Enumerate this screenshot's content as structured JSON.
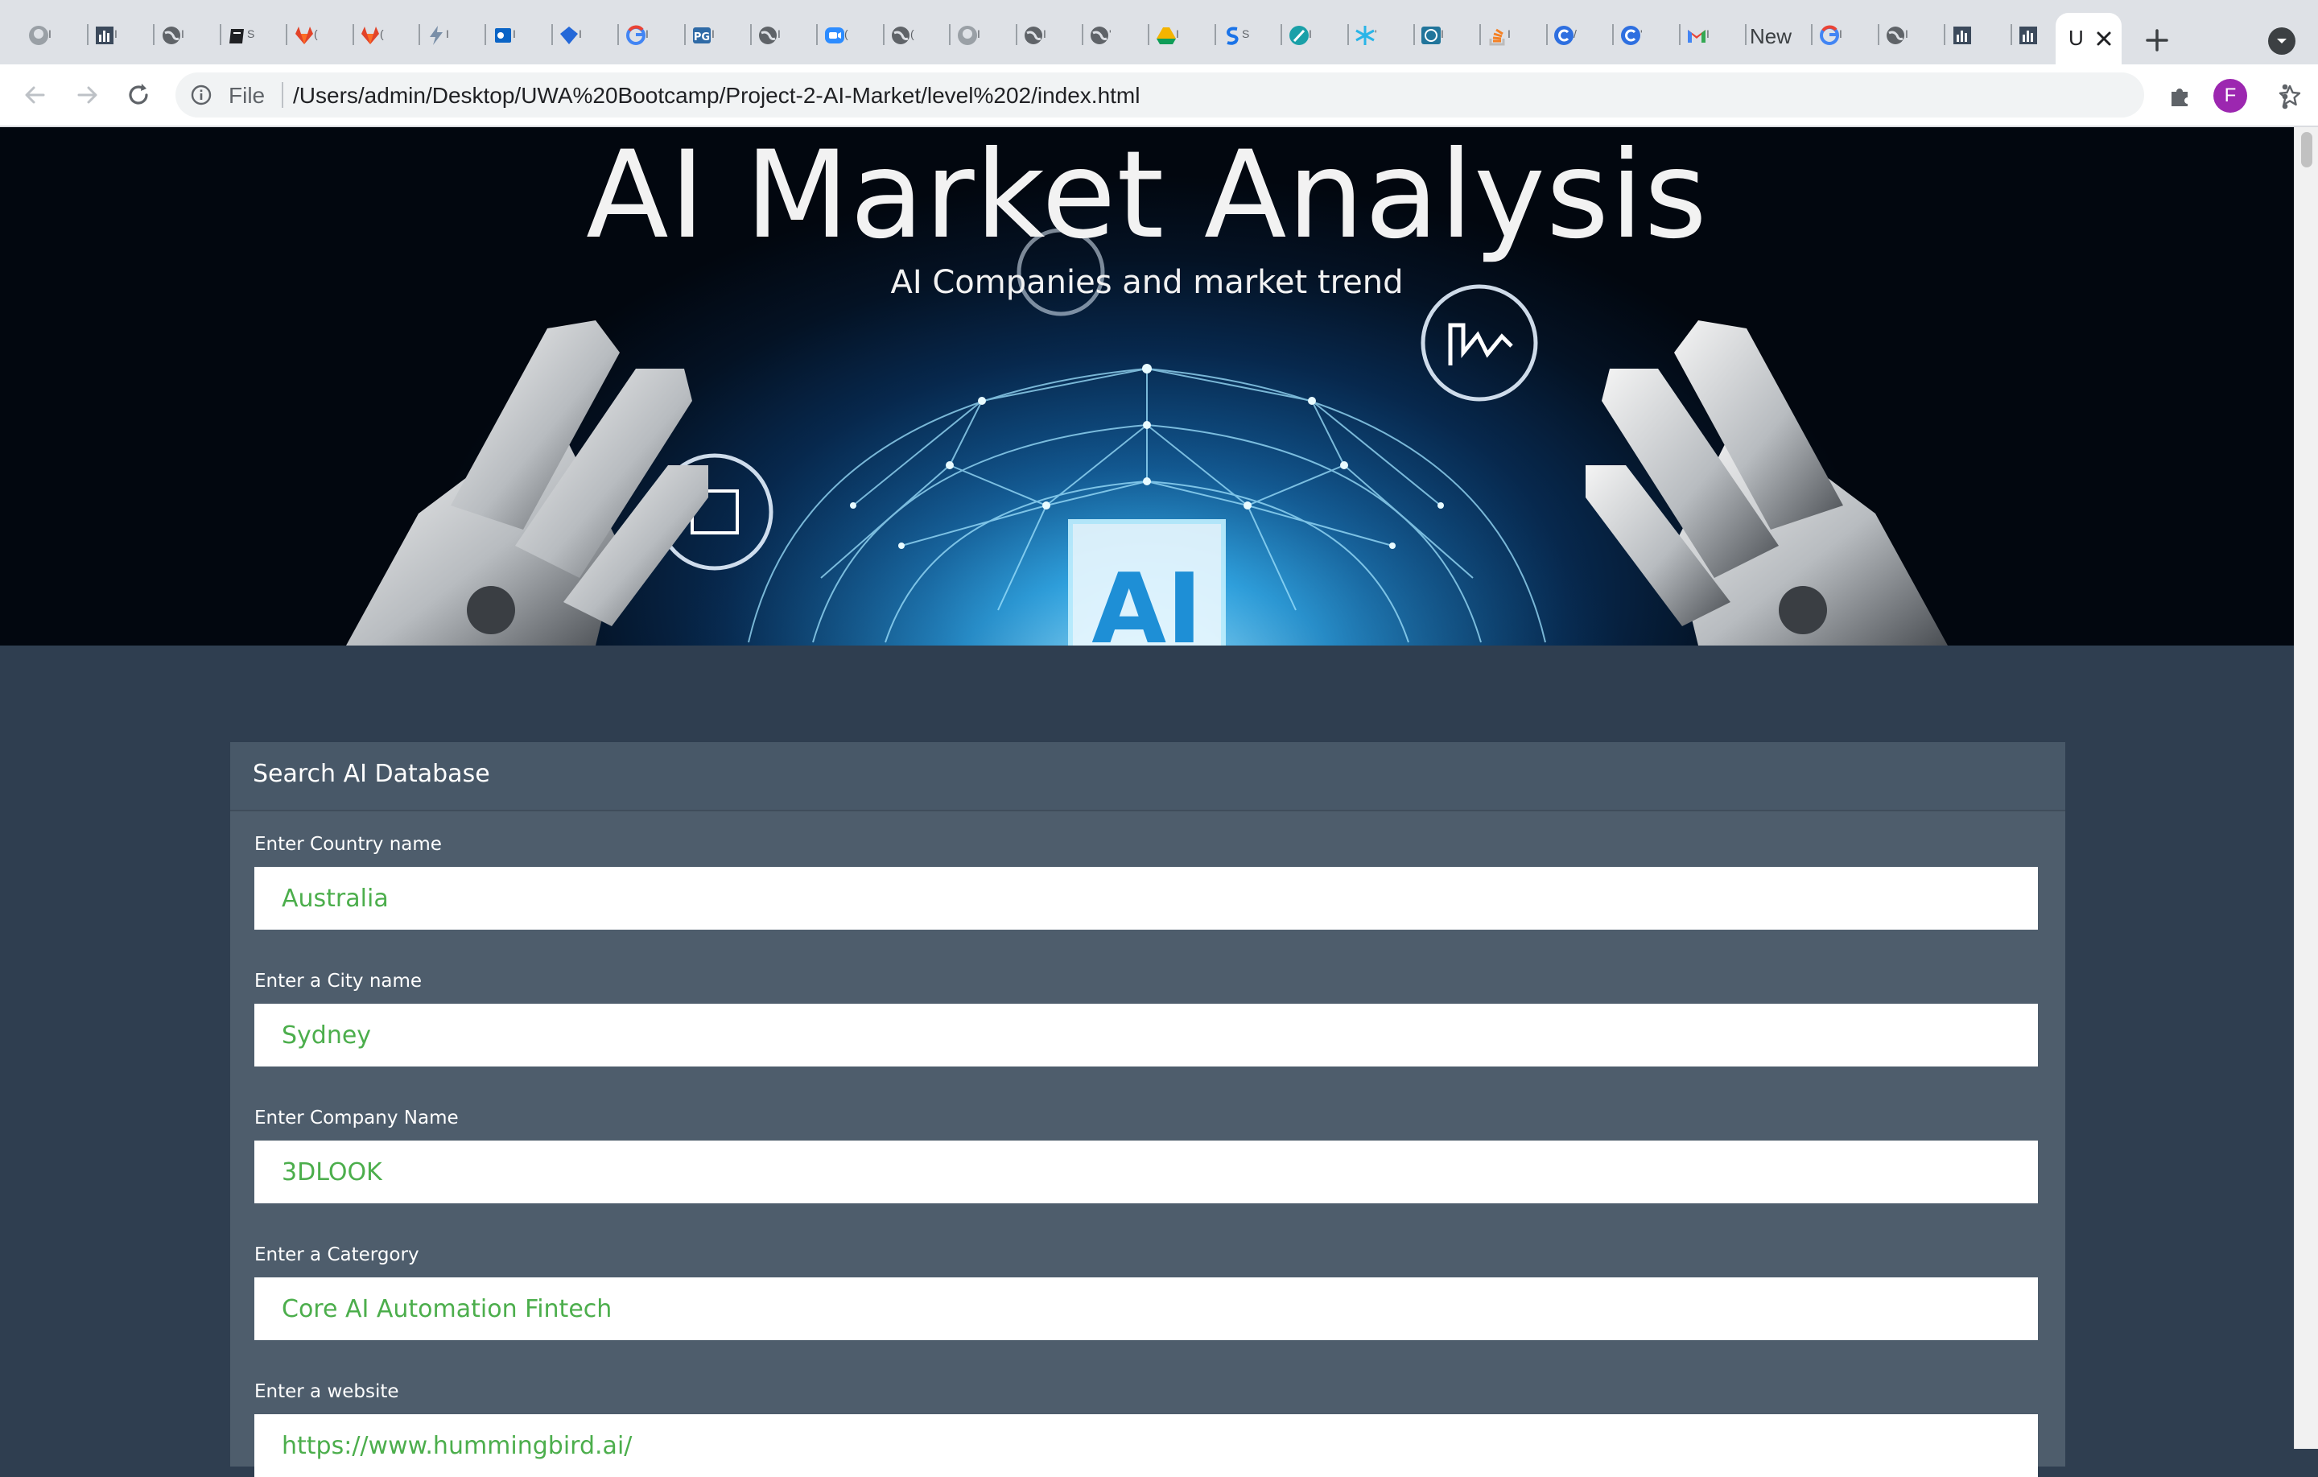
{
  "browser": {
    "tabs": [
      {
        "icon": "github-icon",
        "text": "I"
      },
      {
        "icon": "bar-chart-icon",
        "text": "I"
      },
      {
        "icon": "globe-icon",
        "text": "I"
      },
      {
        "icon": "notebook-icon",
        "text": "S"
      },
      {
        "icon": "gitlab-icon",
        "text": "("
      },
      {
        "icon": "gitlab-icon",
        "text": "("
      },
      {
        "icon": "bolt-icon",
        "text": "I"
      },
      {
        "icon": "outlook-icon",
        "text": "I"
      },
      {
        "icon": "diamond-icon",
        "text": "I"
      },
      {
        "icon": "google-icon",
        "text": "I"
      },
      {
        "icon": "pg-icon",
        "text": "I"
      },
      {
        "icon": "globe-icon",
        "text": "I"
      },
      {
        "icon": "zoom-icon",
        "text": "("
      },
      {
        "icon": "globe-icon",
        "text": "("
      },
      {
        "icon": "github-icon",
        "text": "I"
      },
      {
        "icon": "globe-icon",
        "text": "I"
      },
      {
        "icon": "globe-icon",
        "text": "'"
      },
      {
        "icon": "drive-icon",
        "text": "I"
      },
      {
        "icon": "s-logo-icon",
        "text": "S"
      },
      {
        "icon": "feather-icon",
        "text": "I"
      },
      {
        "icon": "snowflake-icon",
        "text": "'"
      },
      {
        "icon": "wordpress-icon",
        "text": "I"
      },
      {
        "icon": "stackoverflow-icon",
        "text": "I"
      },
      {
        "icon": "c-logo-icon",
        "text": "/"
      },
      {
        "icon": "c-logo-icon",
        "text": "'"
      },
      {
        "icon": "gmail-icon",
        "text": "I"
      },
      {
        "icon": "none",
        "text": "New"
      },
      {
        "icon": "google-icon",
        "text": "I"
      },
      {
        "icon": "globe-icon",
        "text": "I"
      },
      {
        "icon": "bar-chart-icon",
        "text": ""
      },
      {
        "icon": "bar-chart-icon",
        "text": ""
      }
    ],
    "active_tab": {
      "text": "U"
    },
    "omnibox": {
      "scheme": "File",
      "url": "/Users/admin/Desktop/UWA%20Bootcamp/Project-2-AI-Market/level%202/index.html"
    },
    "profile_initial": "F"
  },
  "hero": {
    "title": "AI Market Analysis",
    "subtitle": "AI Companies and market trend",
    "chip_label": "AI"
  },
  "search_panel": {
    "title": "Search AI Database",
    "fields": [
      {
        "label": "Enter Country name",
        "value": "Australia"
      },
      {
        "label": "Enter a City name",
        "value": "Sydney"
      },
      {
        "label": "Enter Company Name",
        "value": "3DLOOK"
      },
      {
        "label": "Enter a Catergory",
        "value": "Core AI Automation Fintech"
      },
      {
        "label": "Enter a website",
        "value": "https://www.hummingbird.ai/"
      }
    ]
  },
  "colors": {
    "page_background": "#2f3e50",
    "panel_background": "#4e5d6c",
    "input_text": "#4cae4c"
  }
}
